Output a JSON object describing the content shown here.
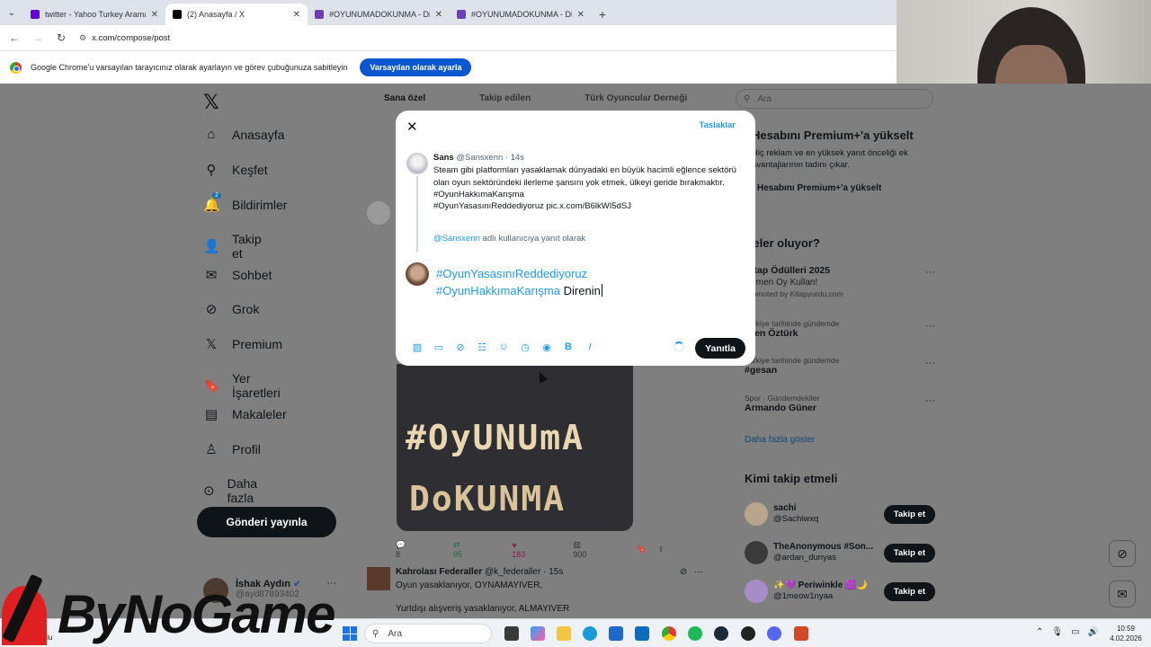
{
  "browser": {
    "tabs": [
      {
        "title": "twitter - Yahoo Turkey Arama S",
        "fav": "#6001d2"
      },
      {
        "title": "(2) Anasayfa / X",
        "fav": "#000000"
      },
      {
        "title": "#OYUNUMADOKUNMA - Dijita",
        "fav": "#6c3fb5"
      },
      {
        "title": "#OYUNUMADOKUNMA - Dijita",
        "fav": "#6c3fb5"
      }
    ],
    "url": "x.com/compose/post",
    "infobar_text": "Google Chrome'u varsayılan tarayıcınız olarak ayarlayın ve görev çubuğunuza sabitleyin",
    "infobar_button": "Varsayılan olarak ayarla"
  },
  "nav": {
    "logo": "𝕏",
    "items": [
      {
        "label": "Anasayfa",
        "icon": "home-icon",
        "glyph": "⌂"
      },
      {
        "label": "Keşfet",
        "icon": "search-icon",
        "glyph": "⚲"
      },
      {
        "label": "Bildirimler",
        "icon": "bell-icon",
        "glyph": "🔔"
      },
      {
        "label": "Takip et",
        "icon": "add-person-icon",
        "glyph": "👤"
      },
      {
        "label": "Sohbet",
        "icon": "mail-icon",
        "glyph": "✉"
      },
      {
        "label": "Grok",
        "icon": "grok-icon",
        "glyph": "⊘"
      },
      {
        "label": "Premium",
        "icon": "x-premium-icon",
        "glyph": "𝕏"
      },
      {
        "label": "Yer İşaretleri",
        "icon": "bookmark-icon",
        "glyph": "🔖"
      },
      {
        "label": "Makaleler",
        "icon": "articles-icon",
        "glyph": "▤"
      },
      {
        "label": "Profil",
        "icon": "profile-icon",
        "glyph": "♙"
      },
      {
        "label": "Daha fazla",
        "icon": "more-circle-icon",
        "glyph": "⊙"
      }
    ],
    "notification_count": "2",
    "post_button": "Gönderi yayınla",
    "user_name": "İshak Aydın",
    "user_handle": "@ayd87893402"
  },
  "feed_tabs": [
    "Sana özel",
    "Takip edilen",
    "Türk Oyuncular Derneği"
  ],
  "search_placeholder": "Ara",
  "premium": {
    "heading": "Hesabını Premium+'a yükselt",
    "desc": "Hiç reklam ve en yüksek yanıt önceliği ek avantajlarının tadını çıkar.",
    "button": "Hesabını Premium+'a yükselt"
  },
  "trends": {
    "heading": "Neler oluyor?",
    "items": [
      {
        "small": "",
        "big": "Kitap Ödülleri 2025",
        "sub": "Hemen Oy Kullan!",
        "sub2": "Promoted by Kitapyurdu.com"
      },
      {
        "small": "Türkiye tarihinde gündemde",
        "big": "Eren Öztürk",
        "sub": "",
        "sub2": ""
      },
      {
        "small": "Türkiye tarihinde gündemde",
        "big": "#gesan",
        "sub": "",
        "sub2": ""
      },
      {
        "small": "Spor · Gündemdekiler",
        "big": "Armando Güner",
        "sub": "",
        "sub2": ""
      }
    ],
    "more": "Daha fazla göster"
  },
  "who_to_follow": {
    "heading": "Kimi takip etmeli",
    "button": "Takip et",
    "users": [
      {
        "name": "sachi",
        "handle": "@Sachiwxq",
        "color": "#b9a58e"
      },
      {
        "name": "TheAnonymous #Son...",
        "handle": "@ardan_dunyas",
        "color": "#3a3a3a"
      },
      {
        "name": "✨💜 Periwinkle 🟪🌙",
        "handle": "@1meow1nyaa",
        "color": "#a88cc8"
      }
    ]
  },
  "post_actions": {
    "replies": "8",
    "reposts": "95",
    "likes": "183",
    "views": "900"
  },
  "image_words": {
    "line1": "#OyUNUmA",
    "line2": "DoKUNMA"
  },
  "reply_tweet": {
    "name": "Kahrolası Federaller",
    "handle": "@k_federaller",
    "time": "· 15s",
    "line1": "Oyun yasaklanıyor, OYNAMAYIVER,",
    "line2": "Yurtdışı alışveriş yasaklanıyor, ALMAYIVER"
  },
  "modal": {
    "drafts": "Taslaklar",
    "orig_name": "Sans",
    "orig_handle": "@Sansxenn",
    "orig_time": "· 14s",
    "orig_text": "Steam gibi platformları yasaklamak dünyadaki en büyük hacimli eğlence sektörü olan oyun sektöründeki ilerleme şansını yok etmek, ülkeyi geride bırakmaktır.",
    "orig_tag1": "#OyunHakkımaKarışma",
    "orig_tag2": "#OyunYasasınıReddediyoruz pic.x.com/B6lkWI5dSJ",
    "replying_user": "@Sansxenn",
    "replying_suffix": " adlı kullanıcıya yanıt olarak",
    "draft_tag1": "#OyunYasasınıReddediyoruz",
    "draft_tag2": "#OyunHakkımaKarışma",
    "draft_text": " Direnin",
    "reply_button": "Yanıtla"
  },
  "taskbar": {
    "weather": "Bulutlu",
    "search": "Ara",
    "time": "10:59",
    "date": "4.02.2026"
  },
  "watermark": "ByNoGame"
}
